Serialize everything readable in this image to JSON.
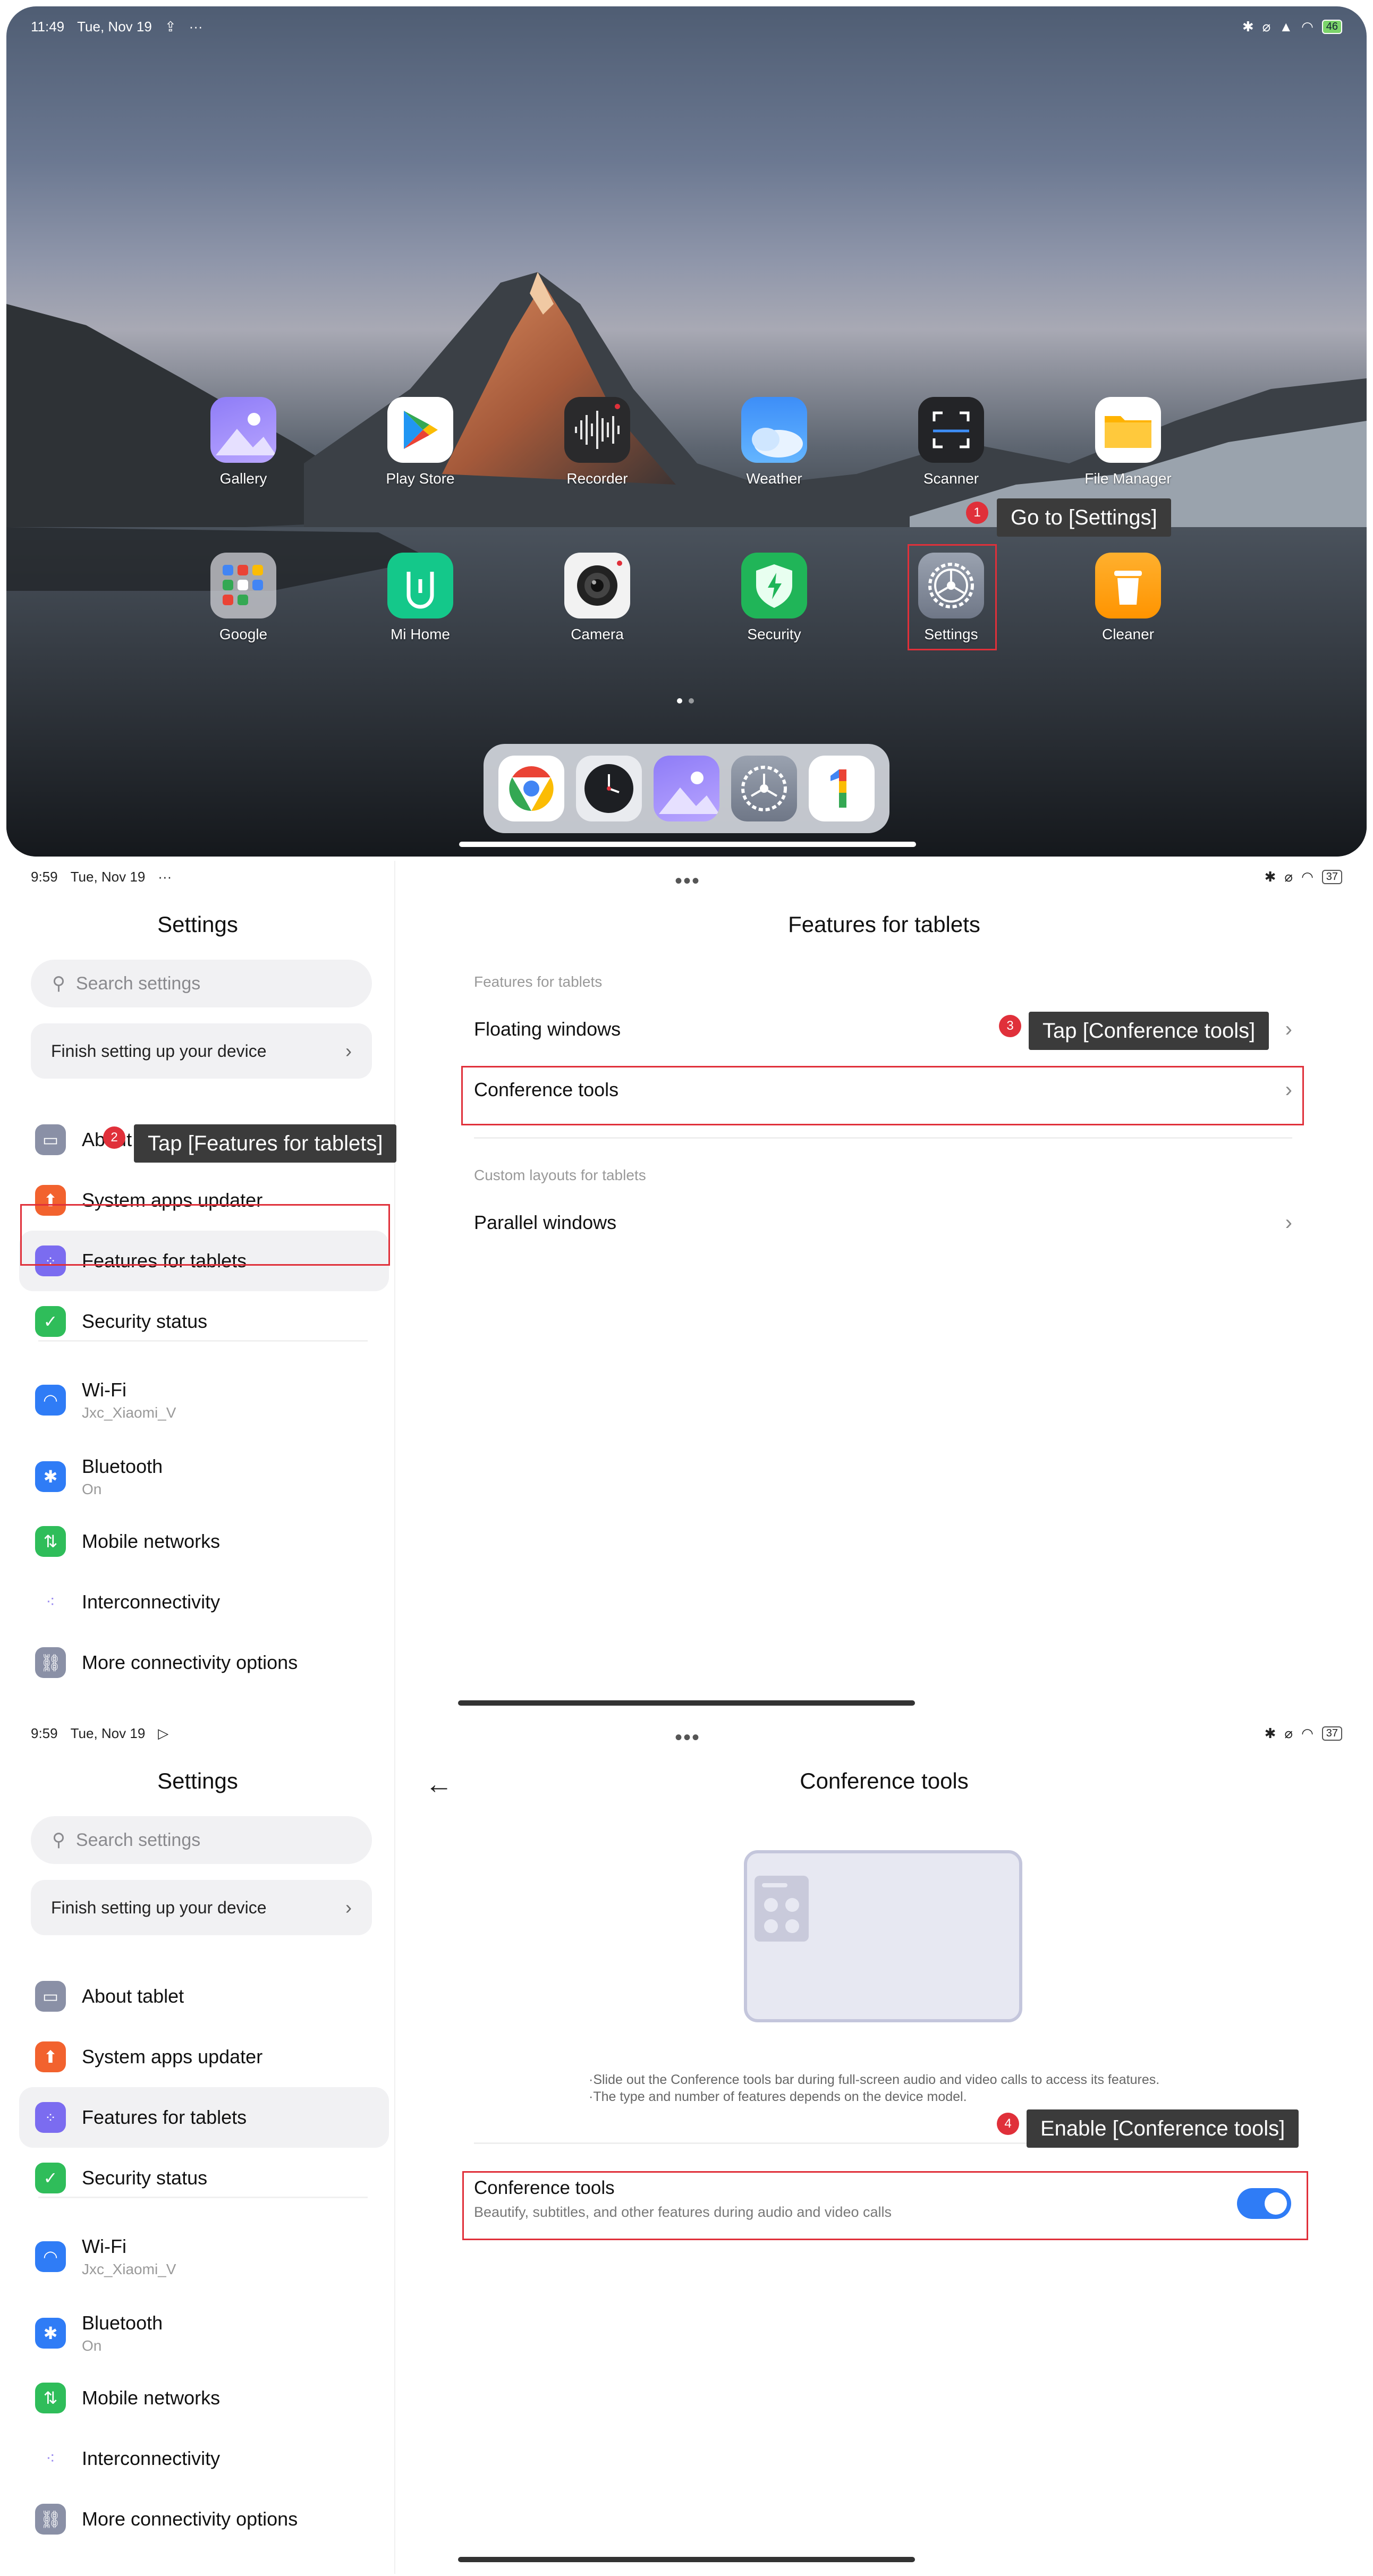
{
  "home": {
    "status": {
      "time": "11:49",
      "date": "Tue, Nov 19",
      "battery": "46"
    },
    "apps_row1": [
      {
        "label": "Gallery",
        "icon": "gallery-icon"
      },
      {
        "label": "Play Store",
        "icon": "play-store-icon"
      },
      {
        "label": "Recorder",
        "icon": "recorder-icon"
      },
      {
        "label": "Weather",
        "icon": "weather-icon"
      },
      {
        "label": "Scanner",
        "icon": "scanner-icon"
      },
      {
        "label": "File Manager",
        "icon": "folder-icon"
      }
    ],
    "apps_row2": [
      {
        "label": "Google",
        "icon": "google-folder-icon"
      },
      {
        "label": "Mi Home",
        "icon": "mi-home-icon"
      },
      {
        "label": "Camera",
        "icon": "camera-icon"
      },
      {
        "label": "Security",
        "icon": "security-icon"
      },
      {
        "label": "Settings",
        "icon": "gear-icon"
      },
      {
        "label": "Cleaner",
        "icon": "trash-icon"
      }
    ],
    "dock": [
      "chrome-icon",
      "clock-icon",
      "gallery-icon",
      "gear-icon",
      "google-one-icon"
    ]
  },
  "steps": {
    "s1": {
      "num": "1",
      "text": "Go to [Settings]"
    },
    "s2": {
      "num": "2",
      "text": "Tap [Features for tablets]"
    },
    "s3": {
      "num": "3",
      "text": "Tap [Conference tools]"
    },
    "s4": {
      "num": "4",
      "text": "Enable [Conference tools]"
    }
  },
  "settings": {
    "status_time": "9:59",
    "status_date": "Tue, Nov 19",
    "battery": "37",
    "title": "Settings",
    "search_placeholder": "Search settings",
    "finish": "Finish setting up your device",
    "items": [
      {
        "name": "About tablet",
        "icon": "tablet-icon",
        "color": "#8a90a6"
      },
      {
        "name": "System apps updater",
        "icon": "arrow-up-icon",
        "color": "#f2622e"
      },
      {
        "name": "Features for tablets",
        "icon": "grid-icon",
        "color": "#7b6cf0"
      },
      {
        "name": "Security status",
        "icon": "shield-check-icon",
        "color": "#2fbd5a"
      }
    ],
    "conn": [
      {
        "name": "Wi-Fi",
        "sub": "Jxc_Xiaomi_V",
        "icon": "wifi-icon",
        "color": "#2f7cf6"
      },
      {
        "name": "Bluetooth",
        "sub": "On",
        "icon": "bluetooth-icon",
        "color": "#2f7cf6"
      },
      {
        "name": "Mobile networks",
        "sub": "",
        "icon": "mobile-data-icon",
        "color": "#2fbd5a"
      },
      {
        "name": "Interconnectivity",
        "sub": "",
        "icon": "interconnect-icon",
        "color": "#ffffff"
      },
      {
        "name": "More connectivity options",
        "sub": "",
        "icon": "link-icon",
        "color": "#8a90a6"
      }
    ]
  },
  "features": {
    "title": "Features for tablets",
    "section1": "Features for tablets",
    "floating": "Floating windows",
    "conference": "Conference tools",
    "section2": "Custom layouts for tablets",
    "parallel": "Parallel windows"
  },
  "conference": {
    "title": "Conference tools",
    "desc1": "·Slide out the Conference tools bar during full-screen audio and video calls to access its features.",
    "desc2": "·The type and number of features depends on the device model.",
    "toggle_title": "Conference tools",
    "toggle_sub": "Beautify, subtitles, and other features during audio and video calls",
    "enabled": true
  }
}
